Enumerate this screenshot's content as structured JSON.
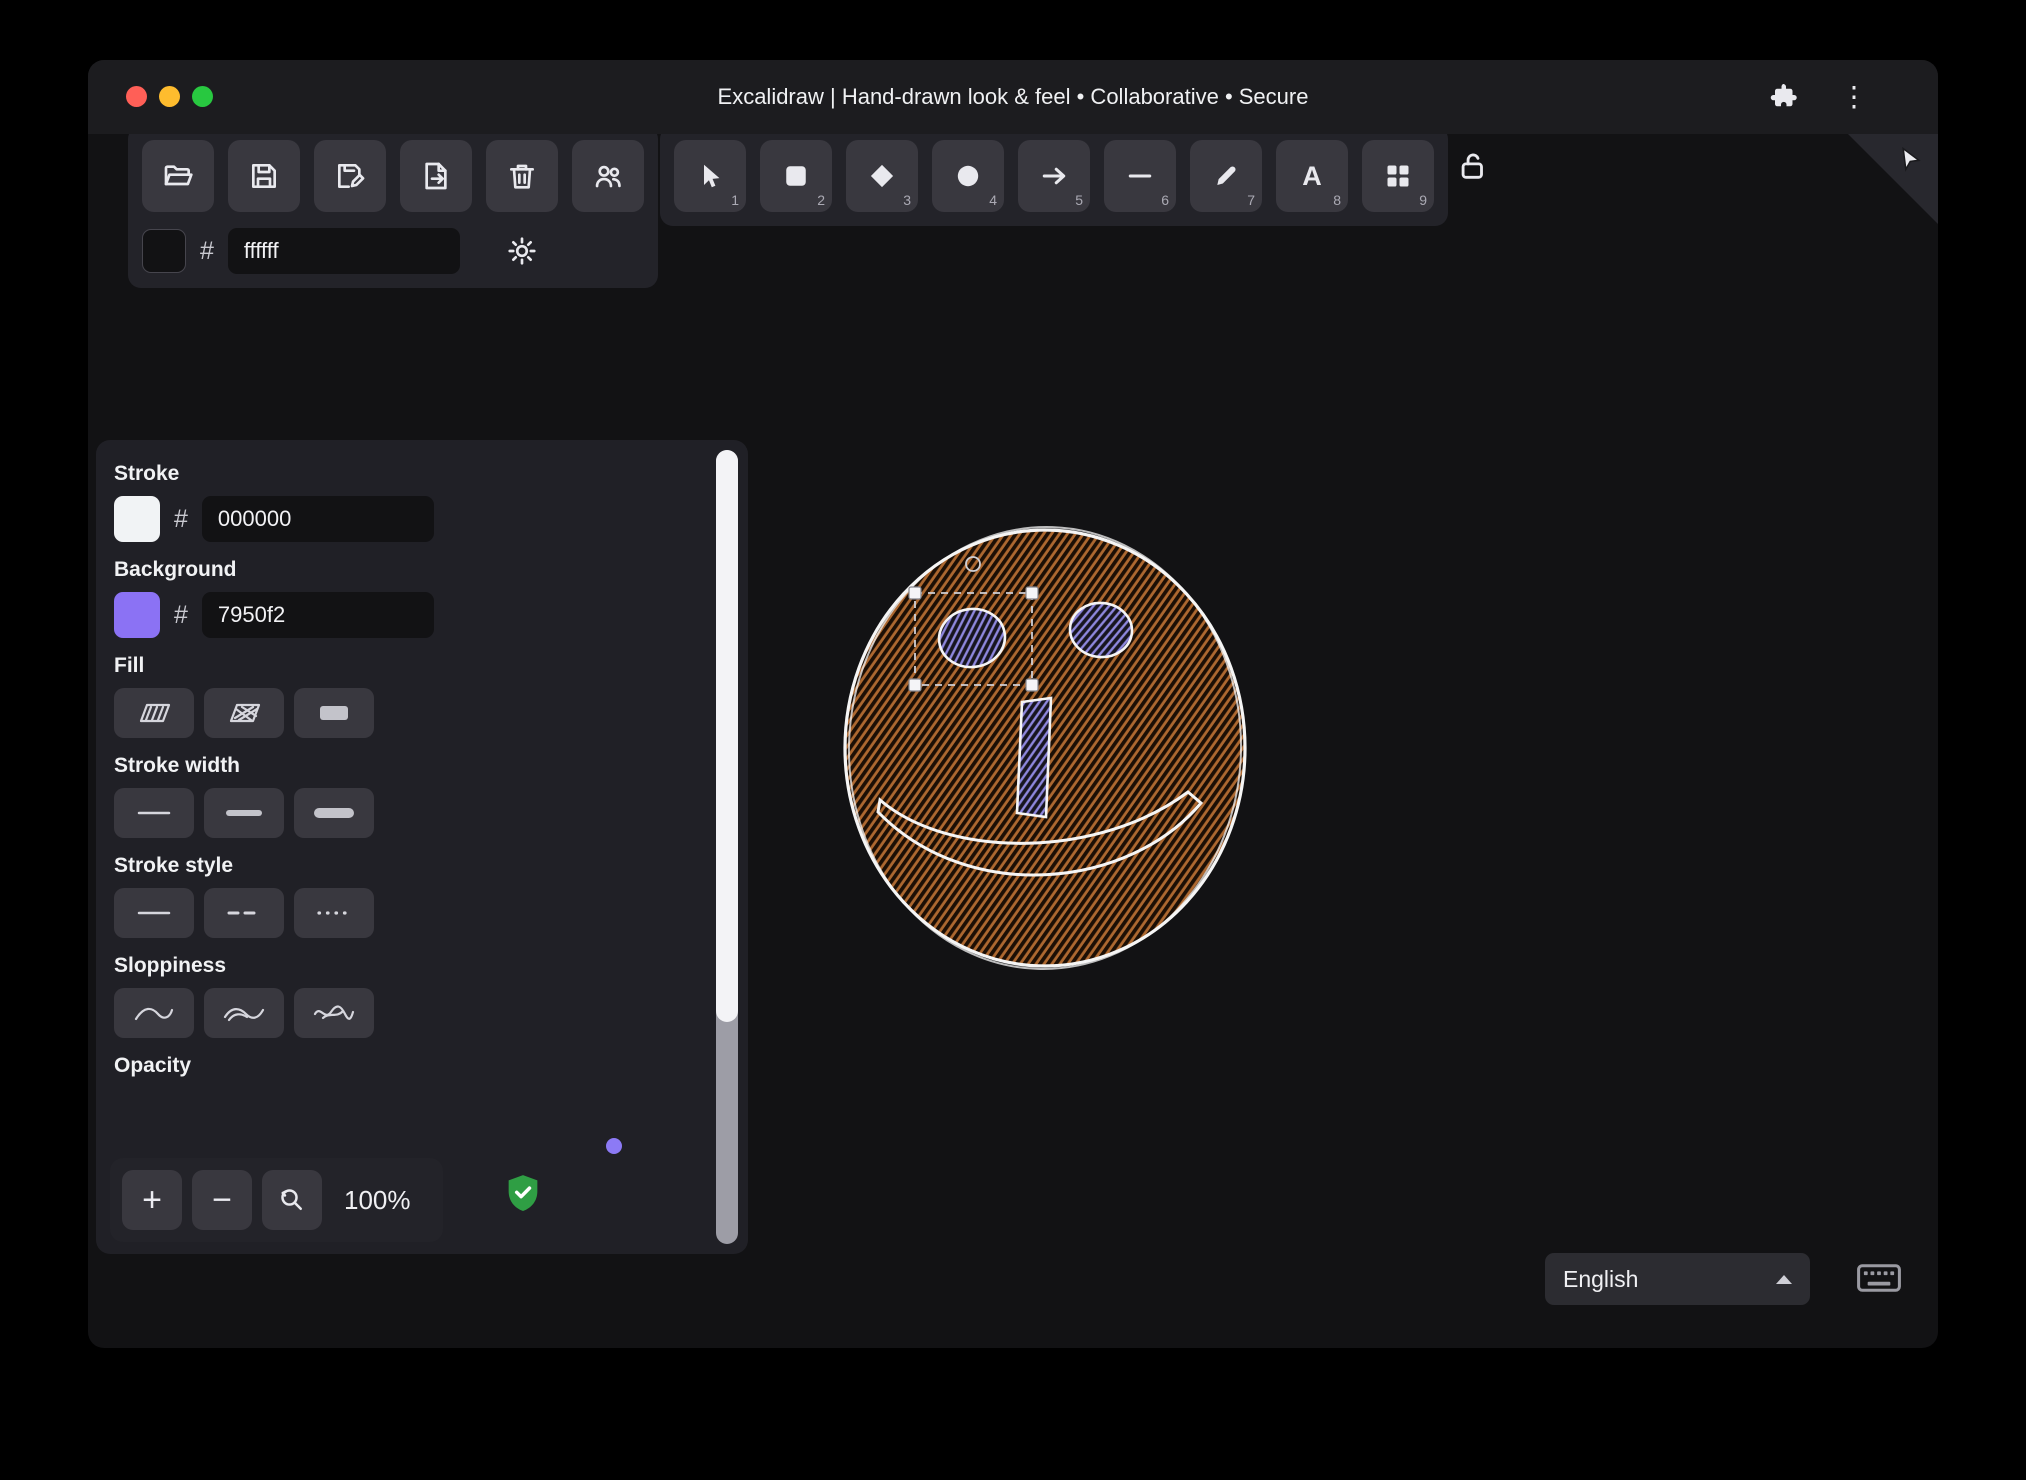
{
  "window": {
    "title": "Excalidraw | Hand-drawn look & feel • Collaborative • Secure",
    "traffic_lights": [
      "close",
      "minimize",
      "fullscreen"
    ]
  },
  "glyphs": {
    "hash": "#",
    "kebab": "⋮",
    "plus": "+",
    "minus": "−"
  },
  "file_toolbar": {
    "buttons": [
      {
        "name": "open-file",
        "icon": "folder-open-icon"
      },
      {
        "name": "save-file",
        "icon": "save-icon"
      },
      {
        "name": "save-as",
        "icon": "save-as-icon"
      },
      {
        "name": "export",
        "icon": "export-icon"
      },
      {
        "name": "clear-canvas",
        "icon": "trash-icon"
      },
      {
        "name": "collaborators",
        "icon": "users-icon"
      }
    ]
  },
  "canvas_background": {
    "value": "ffffff",
    "swatch_color": "#121214",
    "theme_icon": "sun-icon"
  },
  "toolbar": {
    "tools": [
      {
        "name": "selection",
        "shortcut": "1"
      },
      {
        "name": "rectangle",
        "shortcut": "2"
      },
      {
        "name": "diamond",
        "shortcut": "3"
      },
      {
        "name": "ellipse",
        "shortcut": "4"
      },
      {
        "name": "arrow",
        "shortcut": "5"
      },
      {
        "name": "line",
        "shortcut": "6"
      },
      {
        "name": "draw",
        "shortcut": "7"
      },
      {
        "name": "text",
        "shortcut": "8",
        "glyph": "A"
      },
      {
        "name": "library",
        "shortcut": "9"
      }
    ],
    "lock_icon": "unlock-icon"
  },
  "properties": {
    "stroke": {
      "label": "Stroke",
      "value": "000000",
      "swatch_color": "#f1f3f5"
    },
    "background": {
      "label": "Background",
      "value": "7950f2",
      "swatch_color": "#8b72f4"
    },
    "fill": {
      "label": "Fill",
      "options": [
        "hachure",
        "cross-hatch",
        "solid"
      ]
    },
    "stroke_width": {
      "label": "Stroke width",
      "options": [
        "thin",
        "bold",
        "extra-bold"
      ]
    },
    "stroke_style": {
      "label": "Stroke style",
      "options": [
        "solid",
        "dashed",
        "dotted"
      ]
    },
    "sloppiness": {
      "label": "Sloppiness",
      "options": [
        "architect",
        "artist",
        "cartoonist"
      ]
    },
    "opacity": {
      "label": "Opacity"
    }
  },
  "footer": {
    "zoom_level": "100%",
    "shield_color": "#2f9e44"
  },
  "language_select": {
    "value": "English"
  },
  "colors": {
    "accent": "#7950f2",
    "face_hatch": "#ad6830",
    "eye_hatch": "#8e87dd",
    "selection": "#d0d0d6"
  }
}
